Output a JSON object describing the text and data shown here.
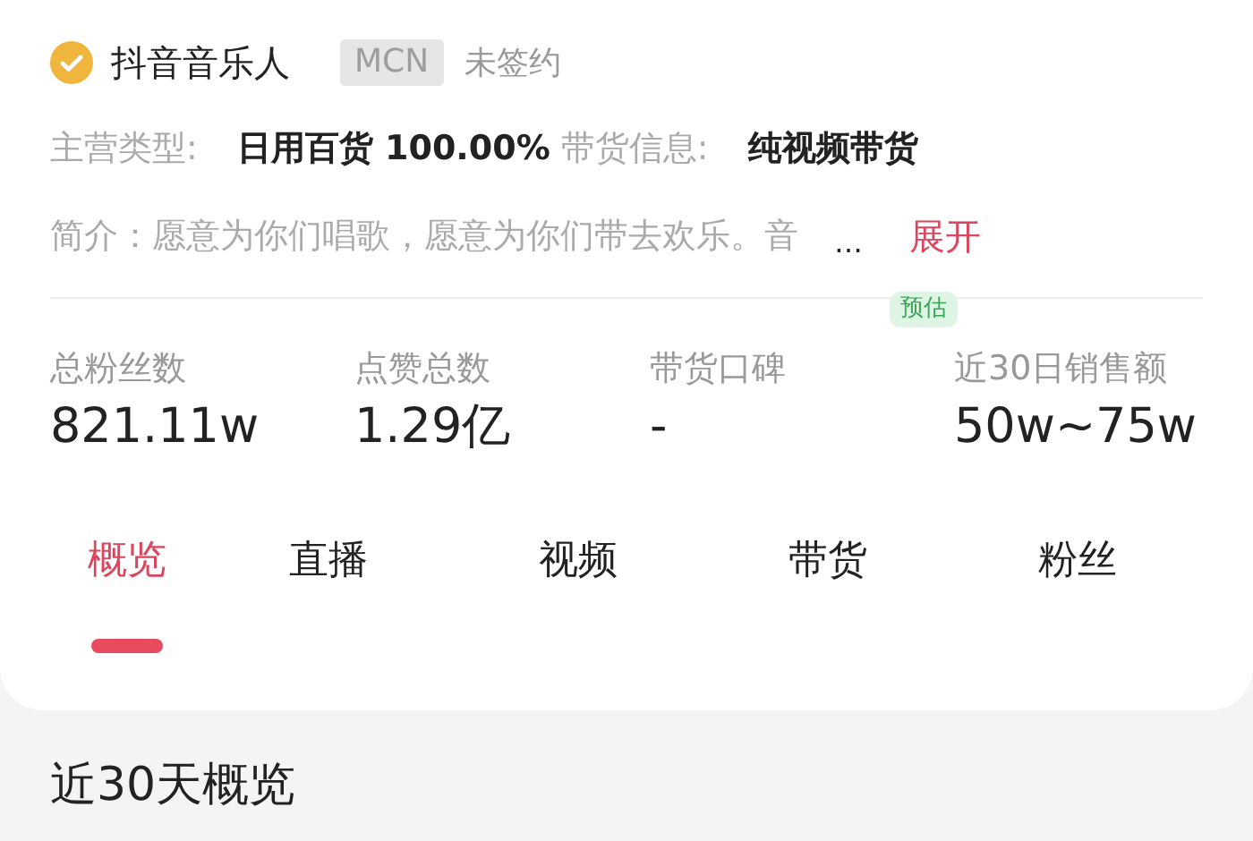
{
  "profile": {
    "verified": true,
    "name": "抖音音乐人",
    "mcn_badge": "MCN",
    "mcn_status": "未签约"
  },
  "info": [
    {
      "label": "主营类型:",
      "value": "日用百货 100.00%"
    },
    {
      "label": "带货信息:",
      "value": "纯视频带货"
    }
  ],
  "bio": {
    "text": "简介：愿意为你们唱歌，愿意为你们带去欢乐。音",
    "ellipsis": "…",
    "expand": "展开"
  },
  "stats": [
    {
      "label": "总粉丝数",
      "value": "821.11w"
    },
    {
      "label": "点赞总数",
      "value": "1.29亿"
    },
    {
      "label": "带货口碑",
      "value": "-"
    },
    {
      "label": "近30日销售额",
      "value": "50w~75w",
      "badge": "预估"
    }
  ],
  "tabs": [
    {
      "label": "概览",
      "selected": true
    },
    {
      "label": "直播",
      "selected": false
    },
    {
      "label": "视频",
      "selected": false
    },
    {
      "label": "带货",
      "selected": false
    },
    {
      "label": "粉丝",
      "selected": false
    }
  ],
  "section_title": "近30天概览"
}
